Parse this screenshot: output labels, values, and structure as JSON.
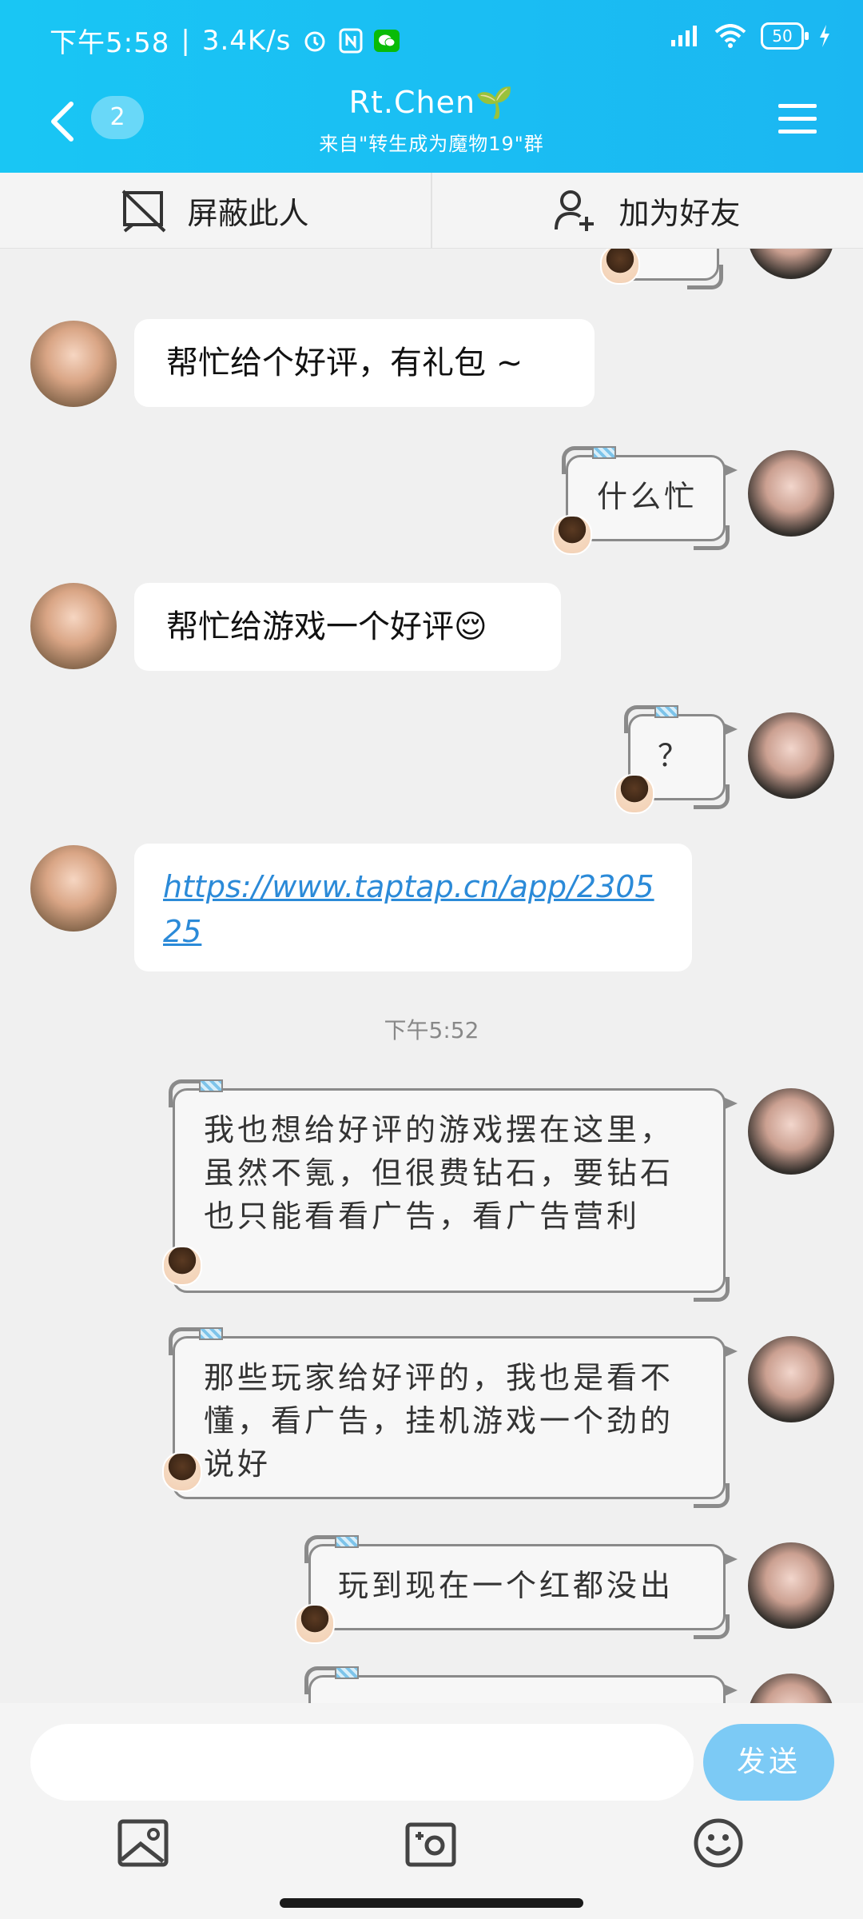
{
  "status_bar": {
    "time": "下午5:58",
    "speed": "3.4K/s",
    "battery": "50"
  },
  "header": {
    "unread_count": "2",
    "title": "Rt.Chen🌱",
    "subtitle": "来自\"转生成为魔物19\"群"
  },
  "actions": {
    "block_label": "屏蔽此人",
    "add_friend_label": "加为好友"
  },
  "messages": [
    {
      "side": "in",
      "text": "帮忙给个好评，有礼包 ~"
    },
    {
      "side": "out",
      "text": "什么忙"
    },
    {
      "side": "in",
      "text": "帮忙给游戏一个好评😌"
    },
    {
      "side": "out",
      "text": "？"
    },
    {
      "side": "in",
      "text": "https://www.taptap.cn/app/230525"
    },
    {
      "side": "out",
      "text": "我也想给好评的游戏摆在这里，虽然不氪，但很费钻石，要钻石也只能看看广告，看广告营利"
    },
    {
      "side": "out",
      "text": "那些玩家给好评的，我也是看不懂，看广告，挂机游戏一个劲的说好"
    },
    {
      "side": "out",
      "text": "玩到现在一个红都没出"
    }
  ],
  "chat_timestamp": "下午5:52",
  "input": {
    "placeholder": "",
    "send_label": "发送"
  },
  "colors": {
    "header_bg": "#1bbaf3",
    "send_bg": "#7ccaf5",
    "link": "#2b8ad8"
  },
  "icons": [
    "back-icon",
    "menu-icon",
    "block-icon",
    "add-friend-icon",
    "image-icon",
    "camera-icon",
    "emoji-icon"
  ]
}
